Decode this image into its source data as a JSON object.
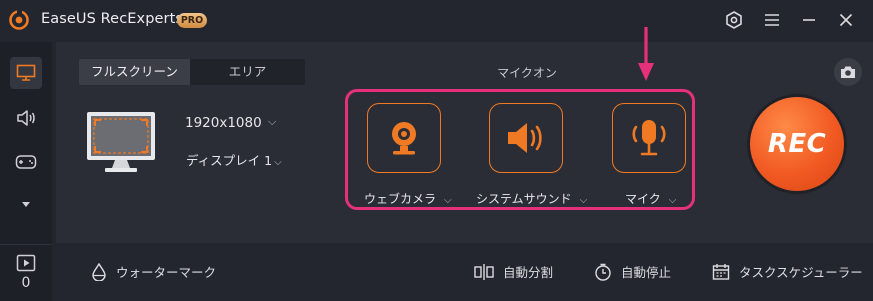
{
  "app": {
    "title": "EaseUS RecExperts",
    "badge": "PRO"
  },
  "titlebar": {
    "icons": [
      "settings-icon",
      "menu-icon",
      "minimize-icon",
      "close-icon"
    ]
  },
  "sidebar": {
    "items": [
      "screen-icon",
      "audio-icon",
      "game-icon",
      "more-icon"
    ],
    "recordings_count": "0"
  },
  "tabs": [
    {
      "label": "フルスクリーン",
      "active": true
    },
    {
      "label": "エリア",
      "active": false
    }
  ],
  "display": {
    "resolution": "1920x1080",
    "display_name": "ディスプレイ 1"
  },
  "audio": {
    "mic_status": "マイクオン",
    "sources": [
      {
        "label": "ウェブカメラ",
        "icon": "webcam-icon"
      },
      {
        "label": "システムサウンド",
        "icon": "speaker-icon"
      },
      {
        "label": "マイク",
        "icon": "microphone-icon"
      }
    ]
  },
  "rec_button": {
    "label": "REC"
  },
  "bottom": {
    "watermark": "ウォーターマーク",
    "auto_split": "自動分割",
    "auto_stop": "自動停止",
    "scheduler": "タスクスケジューラー"
  },
  "colors": {
    "accent": "#f07a23",
    "highlight": "#e7307b",
    "rec": "#f15a22"
  }
}
